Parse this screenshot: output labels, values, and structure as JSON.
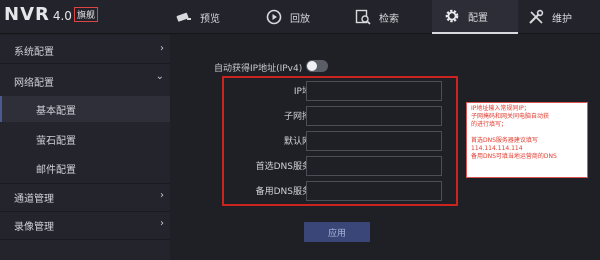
{
  "logo": {
    "brand": "NVR",
    "version": "4.0",
    "edition": "旗舰"
  },
  "nav": [
    {
      "label": "预览",
      "icon": "camera-icon"
    },
    {
      "label": "回放",
      "icon": "playback-icon"
    },
    {
      "label": "检索",
      "icon": "search-icon"
    },
    {
      "label": "配置",
      "icon": "gear-icon",
      "active": true
    },
    {
      "label": "维护",
      "icon": "tools-icon"
    }
  ],
  "sidebar": {
    "items": [
      {
        "label": "系统配置",
        "chevron": "›"
      },
      {
        "label": "网络配置",
        "chevron": "⌄"
      },
      {
        "label": "基本配置",
        "active": true
      },
      {
        "label": "萤石配置"
      },
      {
        "label": "邮件配置"
      },
      {
        "label": "通道管理",
        "chevron": "›"
      },
      {
        "label": "录像管理",
        "chevron": "›"
      }
    ]
  },
  "form": {
    "dhcp_label": "自动获得IP地址(IPv4)",
    "dhcp_enabled": false,
    "fields": [
      {
        "label": "IP地址",
        "value": ""
      },
      {
        "label": "子网掩码",
        "value": ""
      },
      {
        "label": "默认网关",
        "value": ""
      },
      {
        "label": "首选DNS服务器",
        "value": ""
      },
      {
        "label": "备用DNS服务器",
        "value": ""
      }
    ],
    "apply_label": "应用"
  },
  "hint": {
    "lines": [
      "IP地址输入常规同IP；",
      "子网掩码和网关同电脑自动获",
      "的进行填写；",
      "",
      "首选DNS服务器建议填写",
      "114.114.114.114",
      "备用DNS可填当地运营商的DNS"
    ]
  },
  "colors": {
    "accent_red": "#c9241f",
    "apply_button": "#3a4678",
    "background": "#1f2026"
  }
}
